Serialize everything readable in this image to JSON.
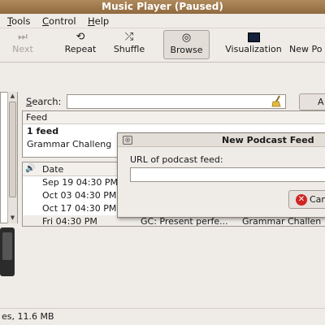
{
  "window": {
    "title": "Music Player (Paused)"
  },
  "menu": {
    "items": [
      {
        "key": "T",
        "rest": "ools"
      },
      {
        "key": "C",
        "rest": "ontrol"
      },
      {
        "key": "H",
        "rest": "elp"
      }
    ]
  },
  "toolbar": {
    "next": {
      "label": "Next",
      "icon": "next-icon"
    },
    "repeat": {
      "label": "Repeat",
      "icon": "repeat-icon"
    },
    "shuffle": {
      "label": "Shuffle",
      "icon": "shuffle-icon"
    },
    "browse": {
      "label": "Browse",
      "icon": "browse-icon"
    },
    "visualization": {
      "label": "Visualization",
      "icon": "visualization-icon"
    },
    "new_podcast": {
      "label": "New Po"
    }
  },
  "search": {
    "key": "S",
    "rest": "earch:",
    "value": "",
    "button_label": "A"
  },
  "feeds": {
    "header": "Feed",
    "count": "1 feed",
    "rows": [
      "Grammar Challeng"
    ]
  },
  "episodes": {
    "header_date": "Date",
    "rows": [
      {
        "date": "Sep 19 04:30 PM",
        "title": "",
        "feed": ""
      },
      {
        "date": "Oct 03 04:30 PM",
        "title": "",
        "feed": ""
      },
      {
        "date": "Oct 17 04:30 PM",
        "title": "",
        "feed": ""
      },
      {
        "date": "Fri 04:30 PM",
        "title": "GC: Present perfe...",
        "feed": "Grammar Challen"
      }
    ]
  },
  "status": {
    "text": "es, 11.6 MB"
  },
  "dialog": {
    "title": "New Podcast Feed",
    "url_label": "URL of podcast feed:",
    "url_value": "",
    "cancel_label": "Can"
  },
  "colors": {
    "titlebar": "#9c7a4e",
    "cancel_icon": "#d02525",
    "selected_row": "#efece8"
  }
}
